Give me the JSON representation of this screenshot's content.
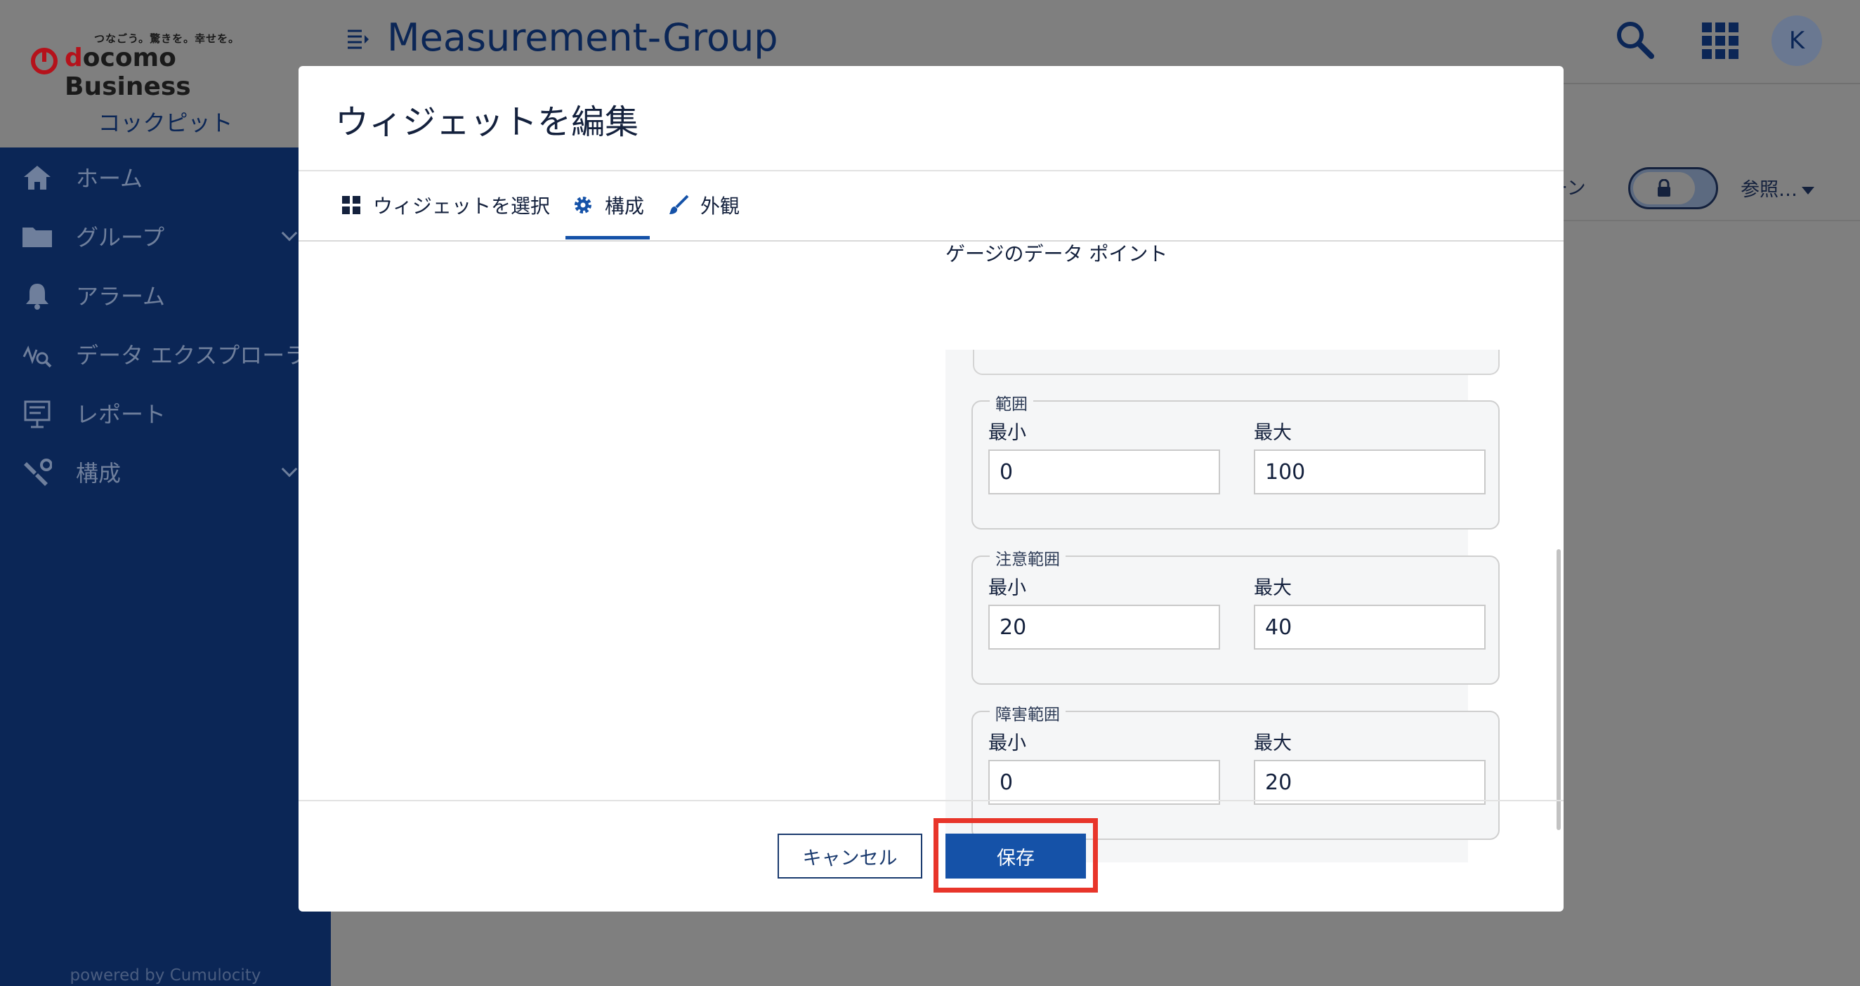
{
  "brand": {
    "tagline": "つなごう。驚きを。幸せを。",
    "name_part1": "d",
    "name_part2": "ocomo Business",
    "app_name": "コックピット",
    "powered_by": "powered by Cumulocity"
  },
  "sidebar": {
    "items": [
      {
        "label": "ホーム",
        "icon": "home-icon",
        "has_children": false
      },
      {
        "label": "グループ",
        "icon": "folder-icon",
        "has_children": true
      },
      {
        "label": "アラーム",
        "icon": "bell-icon",
        "has_children": false
      },
      {
        "label": "データ エクスプローラ",
        "icon": "data-explorer-icon",
        "has_children": false
      },
      {
        "label": "レポート",
        "icon": "report-icon",
        "has_children": false
      },
      {
        "label": "構成",
        "icon": "wrench-icon",
        "has_children": true
      }
    ]
  },
  "header": {
    "title": "Measurement-Group",
    "avatar_initial": "K"
  },
  "toolbar": {
    "partial_label": "ーン",
    "reference_label": "参照…"
  },
  "modal": {
    "title": "ウィジェットを編集",
    "tabs": [
      {
        "label": "ウィジェットを選択",
        "icon": "grid-icon"
      },
      {
        "label": "構成",
        "icon": "gear-icon",
        "active": true
      },
      {
        "label": "外観",
        "icon": "brush-icon"
      }
    ],
    "section_heading": "ゲージのデータ ポイント",
    "ranges": [
      {
        "legend": "範囲",
        "min_label": "最小",
        "max_label": "最大",
        "min_value": "0",
        "max_value": "100"
      },
      {
        "legend": "注意範囲",
        "min_label": "最小",
        "max_label": "最大",
        "min_value": "20",
        "max_value": "40"
      },
      {
        "legend": "障害範囲",
        "min_label": "最小",
        "max_label": "最大",
        "min_value": "0",
        "max_value": "20"
      }
    ],
    "cancel_label": "キャンセル",
    "save_label": "保存"
  },
  "colors": {
    "primary": "#1552a8",
    "sidebar": "#0b2656",
    "highlight": "#e8352a",
    "brand_red": "#b5121b"
  }
}
